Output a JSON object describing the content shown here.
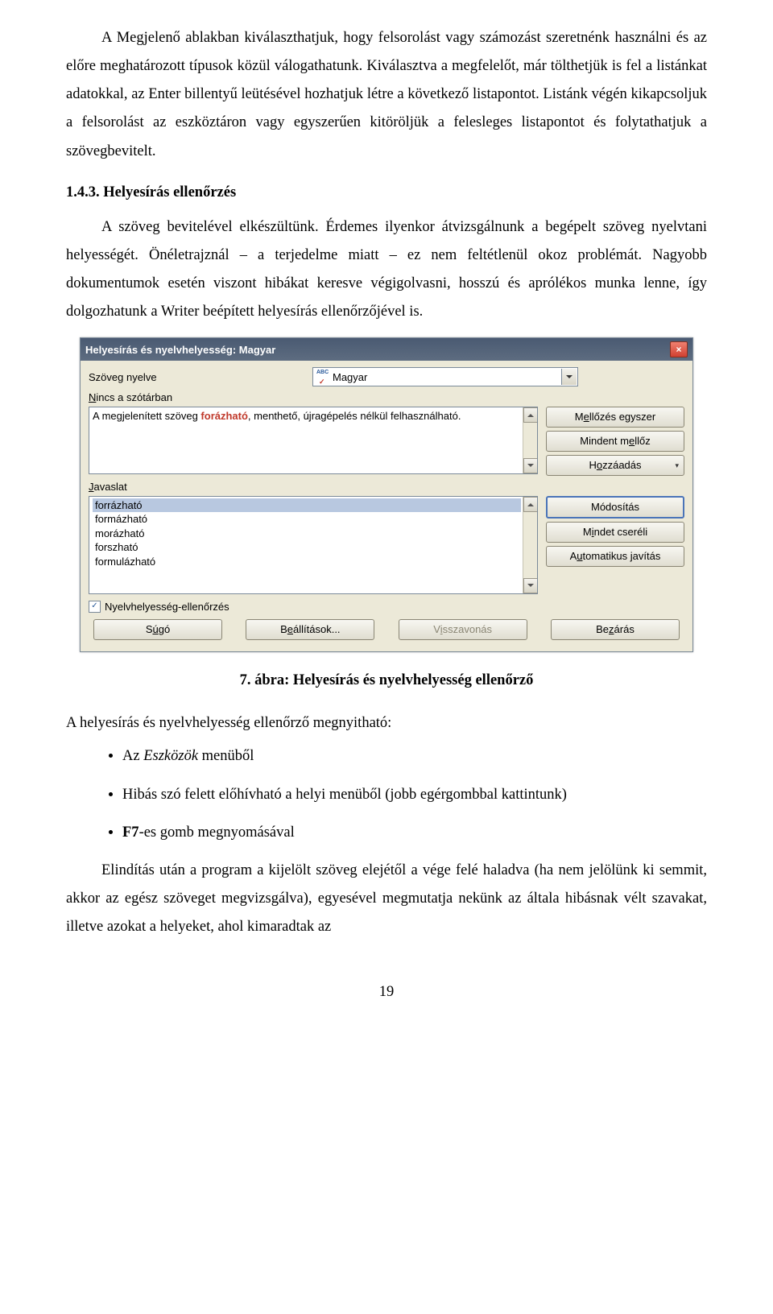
{
  "para1": "A Megjelenő ablakban kiválaszthatjuk, hogy felsorolást vagy számozást szeretnénk használni és az előre meghatározott típusok közül válogathatunk. Kiválasztva a megfelelőt, már tölthetjük is fel a listánkat adatokkal, az Enter billentyű leütésével hozhatjuk létre a következő listapontot. Listánk végén kikapcsoljuk a felsorolást az eszköztáron vagy egyszerűen kitöröljük a felesleges listapontot és folytathatjuk a szövegbevitelt.",
  "heading": "1.4.3. Helyesírás ellenőrzés",
  "para2": "A szöveg bevitelével elkészültünk. Érdemes ilyenkor átvizsgálnunk a begépelt szöveg nyelvtani helyességét. Önéletrajznál – a terjedelme miatt – ez nem feltétlenül okoz problémát. Nagyobb dokumentumok esetén viszont hibákat keresve végigolvasni, hosszú és aprólékos munka lenne, így dolgozhatunk a Writer beépített helyesírás ellenőrzőjével is.",
  "dialog": {
    "title": "Helyesírás és nyelvhelyesség: Magyar",
    "lang_label": "Szöveg nyelve",
    "lang_value": "Magyar",
    "not_in_dict_pre": "N",
    "not_in_dict_post": "incs a szótárban",
    "sentence_pre": "A megjelenített szöveg ",
    "sentence_err": "forázható",
    "sentence_post": ", menthető, újragépelés nélkül felhasználható.",
    "suggestions_label": "Javaslat",
    "suggestions": [
      "forrázható",
      "formázható",
      "morázható",
      "forszható",
      "formulázható"
    ],
    "buttons": {
      "ignore_once_pre": "M",
      "ignore_once_mid": "e",
      "ignore_once_post": "llőzés egyszer",
      "ignore_all_pre": "Mindent m",
      "ignore_all_mid": "e",
      "ignore_all_post": "llőz",
      "add_pre": "H",
      "add_mid": "o",
      "add_post": "zzáadás",
      "change": "Módosítás",
      "change_all_pre": "M",
      "change_all_mid": "i",
      "change_all_post": "ndet cseréli",
      "autocorrect_pre": "A",
      "autocorrect_mid": "u",
      "autocorrect_post": "tomatikus javítás"
    },
    "grammar_check": "Nyelvhelyesség-ellenőrzés",
    "bottom": {
      "help_pre": "S",
      "help_mid": "ú",
      "help_post": "gó",
      "options_pre": "B",
      "options_mid": "e",
      "options_post": "állítások...",
      "undo_pre": "V",
      "undo_mid": "i",
      "undo_post": "sszavonás",
      "close_pre": "Be",
      "close_mid": "z",
      "close_post": "árás"
    }
  },
  "caption": "7. ábra: Helyesírás és nyelvhelyesség ellenőrző",
  "para3": "A helyesírás és nyelvhelyesség ellenőrző megnyitható:",
  "bullets": {
    "b1_pre": "Az ",
    "b1_ital": "Eszközök",
    "b1_post": " menüből",
    "b2": "Hibás szó felett előhívható a helyi menüből (jobb egérgombbal kattintunk)",
    "b3_bold": "F7",
    "b3_post": "-es gomb megnyomásával"
  },
  "para4": "Elindítás után a program a kijelölt szöveg elejétől a vége felé haladva (ha nem jelölünk ki semmit, akkor az egész szöveget megvizsgálva), egyesével megmutatja nekünk az általa hibásnak vélt szavakat, illetve azokat a helyeket, ahol kimaradtak az",
  "page_num": "19"
}
